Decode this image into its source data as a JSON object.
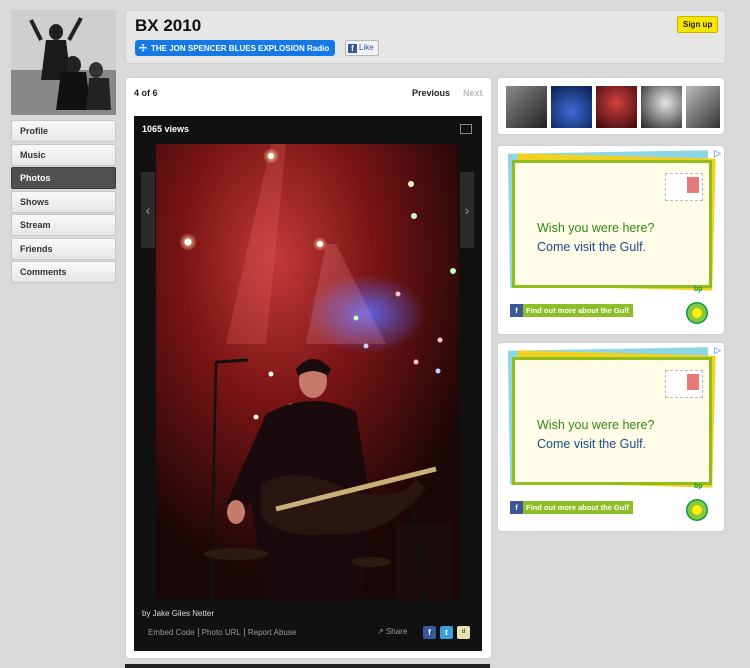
{
  "profile": {
    "title": "BX 2010"
  },
  "header": {
    "radio_label": "THE JON SPENCER BLUES EXPLOSION Radio",
    "like_label": "Like",
    "signup_label": "Sign up"
  },
  "sidebar": {
    "items": [
      {
        "label": "Profile"
      },
      {
        "label": "Music"
      },
      {
        "label": "Photos",
        "active": true
      },
      {
        "label": "Shows"
      },
      {
        "label": "Stream"
      },
      {
        "label": "Friends"
      },
      {
        "label": "Comments"
      }
    ]
  },
  "viewer": {
    "counter": "4 of 6",
    "prev_label": "Previous",
    "next_label": "Next",
    "views": "1065 views",
    "credit": "by Jake Giles Netter",
    "links": [
      "Embed Code",
      "Photo URL",
      "Report Abuse"
    ],
    "share_label": "Share"
  },
  "ads": [
    {
      "line1": "Wish you were here?",
      "line2": "Come visit the Gulf.",
      "cta": "Find out more about the Gulf"
    },
    {
      "line1": "Wish you were here?",
      "line2": "Come visit the Gulf.",
      "cta": "Find out more about the Gulf"
    }
  ],
  "colors": {
    "radio_blue": "#1478e6",
    "signup_yellow": "#f6e600",
    "ad_green": "#8cbf26"
  }
}
